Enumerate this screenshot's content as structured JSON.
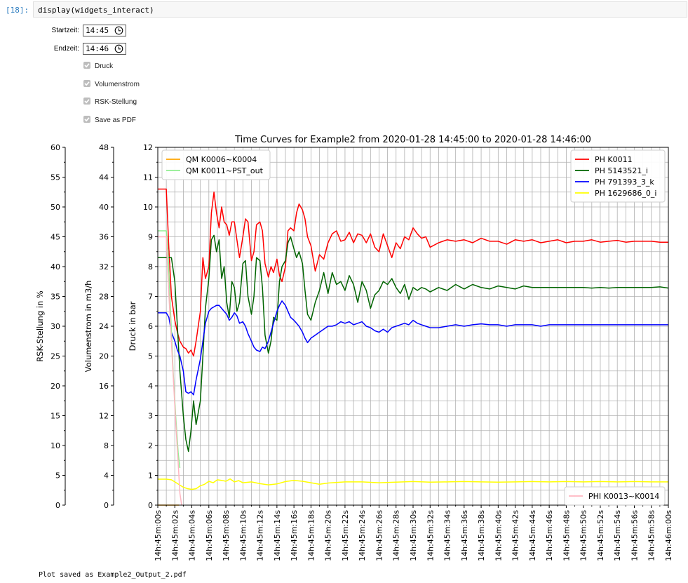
{
  "cell": {
    "prompt": "[18]:",
    "code": "display(widgets_interact)"
  },
  "widgets": {
    "start_label": "Startzeit:",
    "start_value": "14:45",
    "end_label": "Endzeit:",
    "end_value": "14:46",
    "checkboxes": [
      {
        "label": "Druck",
        "checked": true
      },
      {
        "label": "Volumenstrom",
        "checked": true
      },
      {
        "label": "RSK-Stellung",
        "checked": true
      },
      {
        "label": "Save as PDF",
        "checked": true
      }
    ]
  },
  "footer": {
    "message": "Plot saved as Example2_Output_2.pdf"
  },
  "chart_data": {
    "type": "line",
    "title": "Time Curves for Example2 from 2020-01-28 14:45:00 to 2020-01-28 14:46:00",
    "grid": true,
    "x_tick_labels": [
      "14h:45m:00s",
      "14h:45m:02s",
      "14h:45m:04s",
      "14h:45m:06s",
      "14h:45m:08s",
      "14h:45m:10s",
      "14h:45m:12s",
      "14h:45m:14s",
      "14h:45m:16s",
      "14h:45m:18s",
      "14h:45m:20s",
      "14h:45m:22s",
      "14h:45m:24s",
      "14h:45m:26s",
      "14h:45m:28s",
      "14h:45m:30s",
      "14h:45m:32s",
      "14h:45m:34s",
      "14h:45m:36s",
      "14h:45m:38s",
      "14h:45m:40s",
      "14h:45m:42s",
      "14h:45m:44s",
      "14h:45m:46s",
      "14h:45m:48s",
      "14h:45m:50s",
      "14h:45m:52s",
      "14h:45m:54s",
      "14h:45m:56s",
      "14h:45m:58s",
      "14h:46m:00s"
    ],
    "xlim": [
      0,
      60
    ],
    "axes": {
      "druck": {
        "label": "Druck in bar",
        "ylim": [
          0,
          12
        ],
        "ticks": [
          0,
          1,
          2,
          3,
          4,
          5,
          6,
          7,
          8,
          9,
          10,
          11,
          12
        ]
      },
      "volumenstrom": {
        "label": "Volumenstrom in m3/h",
        "ylim": [
          0,
          48
        ],
        "ticks": [
          0,
          4,
          8,
          12,
          16,
          20,
          24,
          28,
          32,
          36,
          40,
          44,
          48
        ]
      },
      "rsk": {
        "label": "RSK-Stellung in %",
        "ylim": [
          0,
          60
        ],
        "ticks": [
          0,
          5,
          10,
          15,
          20,
          25,
          30,
          35,
          40,
          45,
          50,
          55,
          60
        ]
      }
    },
    "legends": {
      "volumenstrom": {
        "position": "upper left",
        "entries": [
          "QM K0006~K0004",
          "QM K0011~PST_out"
        ]
      },
      "druck": {
        "position": "upper right",
        "entries": [
          "PH K0011",
          "PH 5143521_i",
          "PH 791393_3_k",
          "PH 1629686_0_i"
        ]
      },
      "rsk": {
        "position": "lower right",
        "entries": [
          "PHI K0013~K0014"
        ]
      }
    },
    "series": [
      {
        "name": "PH K0011",
        "axis": "druck",
        "color": "#ff0000",
        "x": [
          0,
          1,
          1.3,
          1.6,
          2,
          2.3,
          2.6,
          3,
          3.3,
          3.6,
          3.9,
          4.2,
          4.5,
          5,
          5.3,
          5.6,
          6,
          6.3,
          6.6,
          6.9,
          7.2,
          7.5,
          7.8,
          8.1,
          8.4,
          8.7,
          9,
          9.3,
          9.6,
          10,
          10.3,
          10.6,
          11,
          11.3,
          11.6,
          12,
          12.3,
          12.6,
          13,
          13.3,
          13.6,
          14,
          14.3,
          14.6,
          15,
          15.3,
          15.6,
          16,
          16.3,
          16.6,
          17,
          17.3,
          17.6,
          18,
          18.5,
          19,
          19.5,
          20,
          20.5,
          21,
          21.5,
          22,
          22.5,
          23,
          23.5,
          24,
          24.5,
          25,
          25.5,
          26,
          26.5,
          27,
          27.5,
          28,
          28.5,
          29,
          29.5,
          30,
          30.5,
          31,
          31.5,
          32,
          33,
          34,
          35,
          36,
          37,
          38,
          39,
          40,
          41,
          42,
          43,
          44,
          45,
          46,
          47,
          48,
          49,
          50,
          51,
          52,
          53,
          54,
          55,
          56,
          57,
          58,
          59,
          60
        ],
        "y": [
          10.6,
          10.6,
          8.6,
          7,
          6.2,
          5.8,
          5.5,
          5.3,
          5.25,
          5.1,
          5.2,
          5,
          5.5,
          6.5,
          8.3,
          7.6,
          8,
          9.8,
          10.5,
          9.8,
          9.3,
          10,
          9.5,
          9.4,
          9.05,
          9.5,
          9.5,
          8.9,
          8.3,
          9,
          9.6,
          9.5,
          8.2,
          8.5,
          9.4,
          9.5,
          9.2,
          8.1,
          7.65,
          8,
          7.8,
          8.25,
          7.7,
          7.5,
          8,
          9.2,
          9.3,
          9.2,
          9.8,
          10.1,
          9.9,
          9.6,
          9,
          8.7,
          7.85,
          8.4,
          8.25,
          8.8,
          9.1,
          9.2,
          8.85,
          8.9,
          9.15,
          8.8,
          9.1,
          9.05,
          8.8,
          9.1,
          8.65,
          8.5,
          9.1,
          8.7,
          8.3,
          8.8,
          8.6,
          9,
          8.9,
          9.3,
          9.1,
          8.95,
          9,
          8.65,
          8.8,
          8.9,
          8.85,
          8.9,
          8.8,
          8.95,
          8.85,
          8.85,
          8.75,
          8.9,
          8.85,
          8.9,
          8.8,
          8.85,
          8.9,
          8.8,
          8.85,
          8.85,
          8.9,
          8.82,
          8.85,
          8.88,
          8.82,
          8.85,
          8.85,
          8.85,
          8.82,
          8.82
        ]
      },
      {
        "name": "PH 5143521_i",
        "axis": "druck",
        "color": "#006400",
        "x": [
          0,
          1,
          1.3,
          1.6,
          2,
          2.3,
          2.6,
          3,
          3.3,
          3.6,
          3.9,
          4.2,
          4.5,
          5,
          5.3,
          5.6,
          6,
          6.3,
          6.6,
          6.9,
          7.2,
          7.5,
          7.8,
          8.1,
          8.4,
          8.7,
          9,
          9.3,
          9.6,
          10,
          10.3,
          10.6,
          11,
          11.3,
          11.6,
          12,
          12.3,
          12.6,
          13,
          13.3,
          13.6,
          14,
          14.3,
          14.6,
          15,
          15.3,
          15.6,
          16,
          16.3,
          16.6,
          17,
          17.3,
          17.6,
          18,
          18.5,
          19,
          19.5,
          20,
          20.5,
          21,
          21.5,
          22,
          22.5,
          23,
          23.5,
          24,
          24.5,
          25,
          25.5,
          26,
          26.5,
          27,
          27.5,
          28,
          28.5,
          29,
          29.5,
          30,
          30.5,
          31,
          31.5,
          32,
          33,
          34,
          35,
          36,
          37,
          38,
          39,
          40,
          41,
          42,
          43,
          44,
          45,
          46,
          47,
          48,
          49,
          50,
          51,
          52,
          53,
          54,
          55,
          56,
          57,
          58,
          59,
          60
        ],
        "y": [
          8.3,
          8.3,
          8.3,
          8.3,
          7.5,
          6,
          4.5,
          3,
          2.2,
          1.8,
          2.5,
          3.5,
          2.7,
          3.5,
          5,
          6.6,
          7.6,
          8.9,
          9.05,
          8.5,
          8.9,
          7.6,
          8,
          6.8,
          6.3,
          7.5,
          7.3,
          6.5,
          6.8,
          8.1,
          8.2,
          7,
          6.4,
          7,
          8.3,
          8.2,
          7.3,
          5.7,
          5.1,
          5.5,
          6.3,
          6.2,
          7.5,
          8,
          8.2,
          8.8,
          9,
          8.6,
          8.3,
          8.5,
          8.1,
          7.2,
          6.4,
          6.2,
          6.8,
          7.2,
          7.8,
          7.1,
          7.8,
          7.4,
          7.5,
          7.2,
          7.7,
          7.4,
          6.8,
          7.5,
          7.2,
          6.6,
          7.05,
          7.2,
          7.5,
          7.4,
          7.6,
          7.3,
          7.1,
          7.4,
          6.9,
          7.3,
          7.2,
          7.3,
          7.25,
          7.15,
          7.3,
          7.2,
          7.4,
          7.25,
          7.4,
          7.3,
          7.25,
          7.35,
          7.3,
          7.25,
          7.35,
          7.3,
          7.3,
          7.3,
          7.3,
          7.3,
          7.3,
          7.3,
          7.28,
          7.3,
          7.28,
          7.3,
          7.3,
          7.3,
          7.3,
          7.3,
          7.32,
          7.28
        ]
      },
      {
        "name": "PH 791393_3_k",
        "axis": "druck",
        "color": "#0000ff",
        "x": [
          0,
          1,
          1.3,
          1.6,
          2,
          2.3,
          2.6,
          3,
          3.3,
          3.6,
          3.9,
          4.2,
          4.5,
          5,
          5.3,
          5.6,
          6,
          6.3,
          6.6,
          6.9,
          7.2,
          7.5,
          7.8,
          8.1,
          8.4,
          8.7,
          9,
          9.3,
          9.6,
          10,
          10.3,
          10.6,
          11,
          11.3,
          11.6,
          12,
          12.3,
          12.6,
          13,
          13.3,
          13.6,
          14,
          14.3,
          14.6,
          15,
          15.3,
          15.6,
          16,
          16.3,
          16.6,
          17,
          17.3,
          17.6,
          18,
          18.5,
          19,
          19.5,
          20,
          20.5,
          21,
          21.5,
          22,
          22.5,
          23,
          23.5,
          24,
          24.5,
          25,
          25.5,
          26,
          26.5,
          27,
          27.5,
          28,
          28.5,
          29,
          29.5,
          30,
          30.5,
          31,
          31.5,
          32,
          33,
          34,
          35,
          36,
          37,
          38,
          39,
          40,
          41,
          42,
          43,
          44,
          45,
          46,
          47,
          48,
          49,
          50,
          51,
          52,
          53,
          54,
          55,
          56,
          57,
          58,
          59,
          60
        ],
        "y": [
          6.45,
          6.45,
          6.3,
          5.8,
          5.5,
          5.2,
          5,
          4.5,
          3.8,
          3.75,
          3.8,
          3.7,
          4.2,
          4.9,
          5.5,
          6.1,
          6.5,
          6.6,
          6.65,
          6.7,
          6.7,
          6.6,
          6.5,
          6.4,
          6.2,
          6.3,
          6.45,
          6.35,
          6.1,
          6.15,
          6,
          5.75,
          5.5,
          5.3,
          5.2,
          5.15,
          5.3,
          5.25,
          5.5,
          5.8,
          6.1,
          6.5,
          6.7,
          6.85,
          6.7,
          6.5,
          6.3,
          6.2,
          6.1,
          6.0,
          5.8,
          5.6,
          5.45,
          5.6,
          5.7,
          5.8,
          5.9,
          6.0,
          6.0,
          6.05,
          6.15,
          6.1,
          6.15,
          6.05,
          6.1,
          6.15,
          6.0,
          5.95,
          5.85,
          5.8,
          5.9,
          5.8,
          5.95,
          6.0,
          6.05,
          6.1,
          6.05,
          6.2,
          6.1,
          6.05,
          6.0,
          5.95,
          5.95,
          6.0,
          6.05,
          6.0,
          6.05,
          6.08,
          6.05,
          6.05,
          6.0,
          6.05,
          6.05,
          6.05,
          6.0,
          6.05,
          6.05,
          6.05,
          6.05,
          6.05,
          6.05,
          6.05,
          6.05,
          6.05,
          6.05,
          6.05,
          6.05,
          6.05,
          6.05,
          6.05
        ]
      },
      {
        "name": "PH 1629686_0_i",
        "axis": "druck",
        "color": "#ffff00",
        "x": [
          0,
          1,
          1.6,
          2,
          2.6,
          3,
          3.5,
          4,
          4.5,
          5,
          5.5,
          6,
          6.5,
          7,
          7.5,
          8,
          8.5,
          9,
          9.5,
          10,
          11,
          12,
          13,
          14,
          15,
          16,
          17,
          18,
          19,
          20,
          22,
          24,
          26,
          28,
          30,
          32,
          34,
          36,
          38,
          40,
          42,
          44,
          46,
          48,
          50,
          52,
          54,
          56,
          58,
          60
        ],
        "y": [
          0.87,
          0.87,
          0.85,
          0.78,
          0.67,
          0.6,
          0.55,
          0.53,
          0.55,
          0.65,
          0.7,
          0.8,
          0.75,
          0.85,
          0.83,
          0.8,
          0.88,
          0.78,
          0.82,
          0.75,
          0.78,
          0.72,
          0.68,
          0.71,
          0.79,
          0.83,
          0.8,
          0.75,
          0.7,
          0.74,
          0.78,
          0.78,
          0.75,
          0.77,
          0.79,
          0.77,
          0.78,
          0.79,
          0.78,
          0.77,
          0.78,
          0.79,
          0.78,
          0.79,
          0.78,
          0.79,
          0.78,
          0.79,
          0.78,
          0.78
        ]
      },
      {
        "name": "QM K0006~K0004",
        "axis": "volumenstrom",
        "color": "#ffa500",
        "x": [
          0,
          1,
          1.5,
          2,
          2.5
        ],
        "y": [
          0,
          0,
          0,
          0,
          0
        ]
      },
      {
        "name": "QM K0011~PST_out",
        "axis": "volumenstrom",
        "color": "#90ee90",
        "x": [
          0,
          1,
          1.2,
          1.5,
          1.8,
          2.1,
          2.4,
          2.6
        ],
        "y": [
          36.8,
          36.8,
          34,
          26,
          18,
          12,
          7,
          5
        ]
      },
      {
        "name": "PHI K0013~K0014",
        "axis": "rsk",
        "color": "#ffb6c1",
        "x": [
          0,
          1,
          1.2,
          1.5,
          1.8,
          2.1,
          2.4,
          2.6,
          2.8
        ],
        "y": [
          45,
          45,
          38,
          30,
          22,
          14,
          7,
          2,
          0
        ]
      }
    ]
  }
}
